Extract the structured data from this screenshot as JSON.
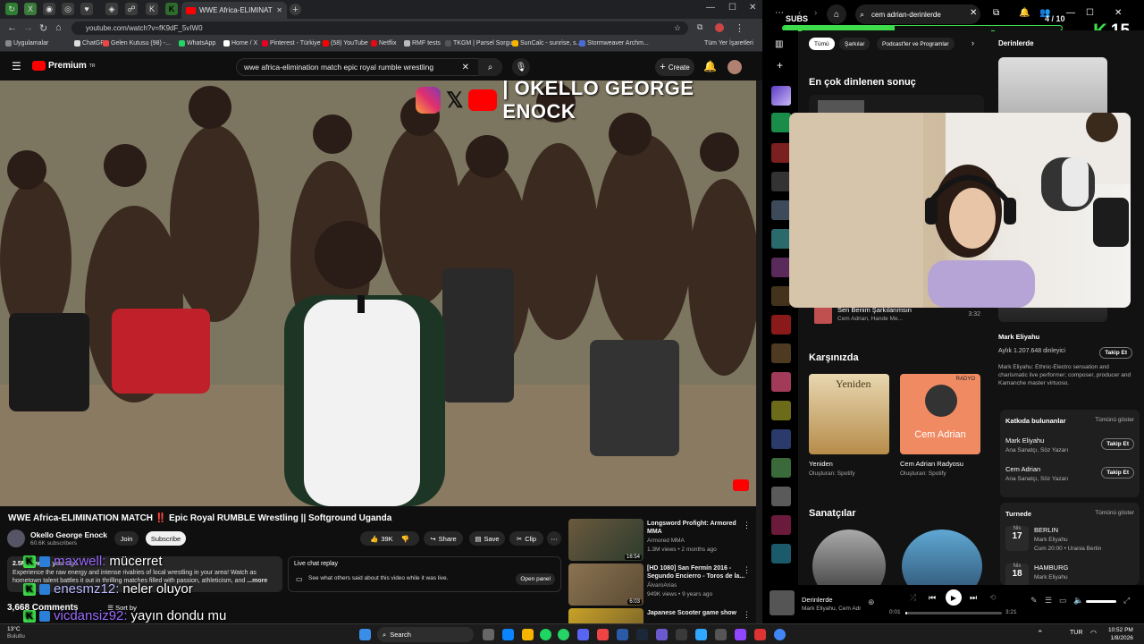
{
  "browser": {
    "active_tab_title": "WWE Africa-ELIMINATION MA",
    "url": "youtube.com/watch?v=fK9dF_5vIW0",
    "pinned_tabs": [
      "↻",
      "X",
      "◉",
      "◎",
      "♥",
      "◈",
      "☍",
      "K"
    ],
    "bookmarks": [
      "Uygulamalar",
      "ChatGPT",
      "Gelen Kutusu (98) -...",
      "WhatsApp",
      "Home / X",
      "Pinterest - Türkiye",
      "(58) YouTube",
      "Netflix",
      "RMF tests",
      "TKGM | Parsel Sorgu...",
      "SunCalc - sunrise, s...",
      "Stormweaver Archm..."
    ],
    "bookmarks_right": "Tüm Yer İşaretleri"
  },
  "youtube": {
    "logo": "Premium",
    "logo_region": "TR",
    "search_query": "wwe africa-elimination match epic royal rumble wrestling",
    "create_label": "Create",
    "video_overlay_name": "| OKELLO GEORGE ENOCK",
    "title": "WWE Africa-ELIMINATION MATCH ‼️ Epic Royal RUMBLE Wrestling || Softground Uganda",
    "channel_name": "Okello George Enock",
    "subscribers": "60.6K subscribers",
    "join_label": "Join",
    "subscribe_label": "Subscribe",
    "likes": "39K",
    "share_label": "Share",
    "save_label": "Save",
    "clip_label": "Clip",
    "description_stats": "2.5M views 1 year ago",
    "description_line1": "Experience the raw energy and intense rivalries of local wrestling in your area! Watch as",
    "description_line2": "hometown talent battles it out in thrilling matches filled with passion, athleticism, and",
    "description_more": "...more",
    "live_chat_title": "Live chat replay",
    "live_chat_text": "See what others said about this video while it was live.",
    "open_panel_label": "Open panel",
    "comments_count": "3,668 Comments",
    "sort_by_label": "Sort by",
    "related": [
      {
        "title": "Longsword Profight: Armored MMA",
        "channel": "Armored MMA",
        "meta": "1.3M views • 2 months ago",
        "duration": "16:54"
      },
      {
        "title": "[HD 1080] San Fermín 2016 - Segundo Encierro - Toros de la...",
        "channel": "ÁlvaroArias",
        "meta": "949K views • 9 years ago",
        "duration": "6:03"
      },
      {
        "title": "Japanese Scooter game show",
        "channel": "",
        "meta": "",
        "duration": ""
      }
    ]
  },
  "stream_chat": [
    {
      "user": "maxwell:",
      "message": "mücerret"
    },
    {
      "user": "enesmz12:",
      "message": "neler oluyor"
    },
    {
      "user": "vicdansiz92:",
      "message": "yayın dondu mu"
    }
  ],
  "stream_overlay": {
    "subs_label": "SUBS",
    "subs_progress": "4 / 10",
    "subs_fraction": 0.4,
    "kick_count": "15"
  },
  "spotify": {
    "search_query": "cem adrian-derinlerde",
    "chips": [
      "Tümü",
      "Şarkılar",
      "Podcast'ler ve Programlar"
    ],
    "top_result_heading": "En çok dinlenen sonuç",
    "song_row": {
      "title": "Sen Benim Şarkılarımsın",
      "artists": "Cem Adrian, Hande Me...",
      "duration": "3:32"
    },
    "featuring_heading": "Karşınızda",
    "featuring_cards": [
      {
        "name": "Yeniden",
        "sub": "Oluşturan: Spotify",
        "cover_text": "Yeniden"
      },
      {
        "name": "Cem Adrian Radyosu",
        "sub": "Oluşturan: Spotify",
        "cover_text": "Cem Adrian",
        "badge": "RADYO"
      }
    ],
    "artists_heading": "Sanatçılar",
    "right_panel_title": "Derinlerde",
    "artist_name": "Mark Eliyahu",
    "monthly_listeners": "Aylık 1.207.648 dinleyici",
    "follow_label": "Takip Et",
    "artist_bio": "Mark Eliyahu: Ethnic-Electro sensation and charismatic live performer; composer, producer and Kamanche master virtuoso.",
    "credits_heading": "Katkıda bulunanlar",
    "show_all_label": "Tümünü göster",
    "credits": [
      {
        "name": "Mark Eliyahu",
        "role": "Ana Sanatçı, Söz Yazarı"
      },
      {
        "name": "Cem Adrian",
        "role": "Ana Sanatçı, Söz Yazarı"
      }
    ],
    "tour_heading": "Turnede",
    "tour": [
      {
        "month": "Nis",
        "day": "17",
        "city": "BERLIN",
        "artist": "Mark Eliyahu",
        "details": "Cum 20:00 • Urania Berlin"
      },
      {
        "month": "Nis",
        "day": "18",
        "city": "HAMBURG",
        "artist": "Mark Eliyahu",
        "details": ""
      }
    ],
    "now_playing_title": "Derinlerde",
    "now_playing_artists": "Mark Eliyahu, Cem Adrian",
    "elapsed": "0:01",
    "total": "3:21",
    "progress": 0.01
  },
  "taskbar": {
    "weather_temp": "13°C",
    "weather_desc": "Bulutlu",
    "search_label": "Search",
    "lang": "TUR",
    "time": "10:52 PM",
    "date": "1/8/2026"
  },
  "colors": {
    "youtube_red": "#ff0000",
    "kick_green": "#3ddc4a",
    "spotify_green": "#1ed760",
    "chat_user_purple": "#9b6bff"
  }
}
